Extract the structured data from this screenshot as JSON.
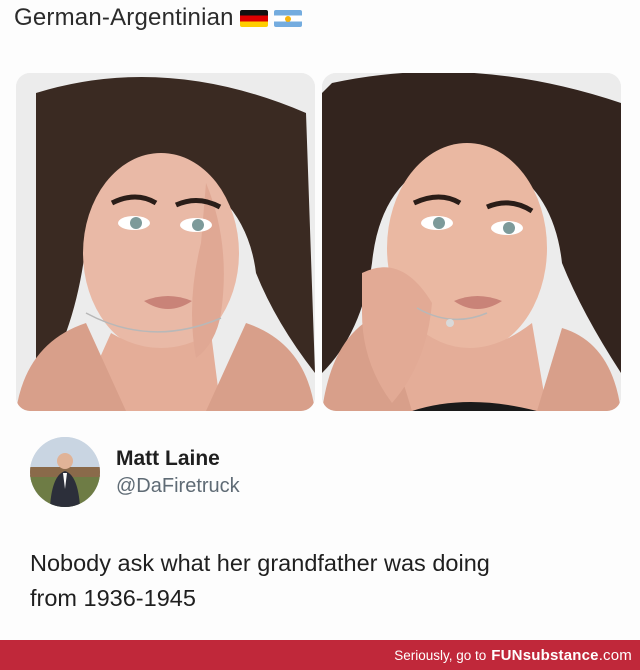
{
  "header": {
    "title": "German-Argentinian",
    "flags": [
      "flag-germany-icon",
      "flag-argentina-icon"
    ]
  },
  "photos": {
    "count": 2,
    "description_icons": [
      "portrait-photo",
      "portrait-photo"
    ]
  },
  "tweet": {
    "display_name": "Matt Laine",
    "handle": "@DaFiretruck",
    "text_line1": "Nobody ask what her grandfather was doing",
    "text_line2": "from 1936-1945"
  },
  "footer": {
    "text": "Seriously, go to",
    "brand_bold": "FUN",
    "brand_mid": "substance",
    "brand_tail": ".com",
    "bar_color": "#c0283a"
  }
}
